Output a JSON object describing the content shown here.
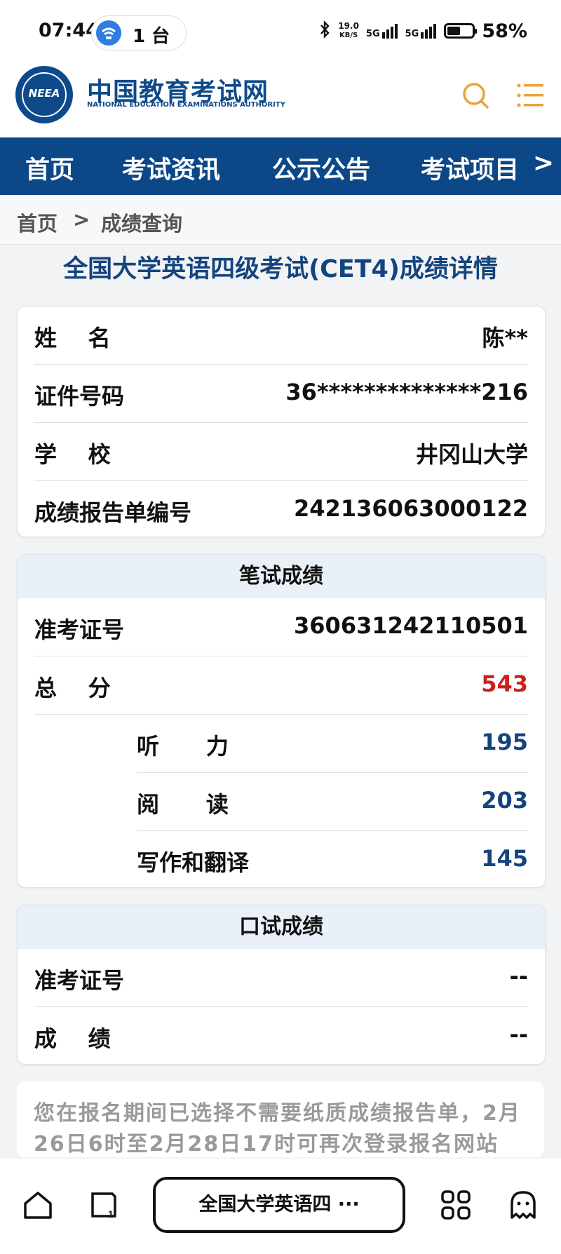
{
  "status_bar": {
    "time": "07:44",
    "device_count": "1 台",
    "net_speed_value": "19.0",
    "net_speed_unit": "KB/S",
    "signal1": "5G",
    "signal2": "5G",
    "battery_percent": "58%",
    "battery_level": 0.58
  },
  "header": {
    "logo_letters": "NEEA",
    "site_name_cn": "中国教育考试网",
    "site_name_en": "NATIONAL EDUCATION EXAMINATIONS AUTHORITY"
  },
  "nav": {
    "items": [
      "首页",
      "考试资讯",
      "公示公告",
      "考试项目"
    ],
    "more": ">"
  },
  "breadcrumb": {
    "home": "首页",
    "separator": ">",
    "current": "成绩查询"
  },
  "page_title": "全国大学英语四级考试(CET4)成绩详情",
  "personal_info": {
    "rows": [
      {
        "label": "姓    名",
        "value": "陈**"
      },
      {
        "label": "证件号码",
        "value": "36**************216"
      },
      {
        "label": "学    校",
        "value": "井冈山大学"
      },
      {
        "label": "成绩报告单编号",
        "value": "242136063000122"
      }
    ]
  },
  "written": {
    "title": "笔试成绩",
    "admission_label": "准考证号",
    "admission_value": "360631242110501",
    "total_label": "总    分",
    "total_value": "543",
    "subs": [
      {
        "label": "听      力",
        "value": "195"
      },
      {
        "label": "阅      读",
        "value": "203"
      },
      {
        "label": "写作和翻译",
        "value": "145"
      }
    ]
  },
  "oral": {
    "title": "口试成绩",
    "admission_label": "准考证号",
    "admission_value": "--",
    "score_label": "成    绩",
    "score_value": "--"
  },
  "notice": {
    "line1": "您在报名期间已选择不需要纸质成绩报告单，2月",
    "line2": "26日6时至2月28日17时可再次登录报名网站"
  },
  "bottom_bar": {
    "tab_title": "全国大学英语四 ···"
  },
  "colors": {
    "brand_blue": "#0c4787",
    "title_blue": "#14447e",
    "accent_orange": "#e8a33d",
    "total_red": "#cc1f1f"
  }
}
